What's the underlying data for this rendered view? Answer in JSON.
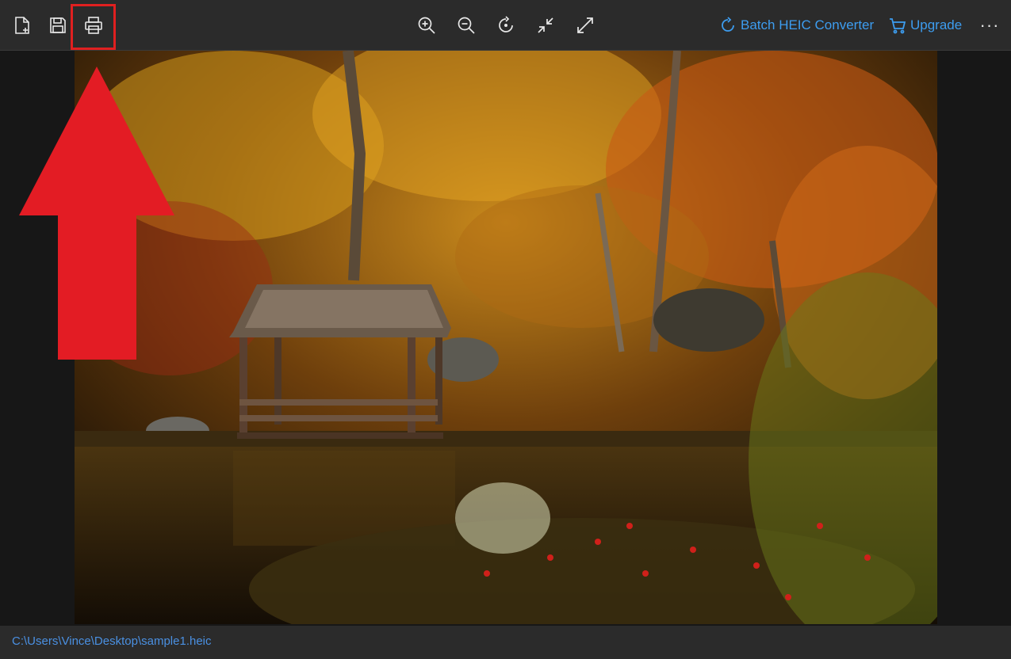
{
  "toolbar": {
    "left_icons": [
      "new-file-icon",
      "save-icon",
      "print-icon"
    ],
    "center_icons": [
      "zoom-in-icon",
      "zoom-out-icon",
      "rotate-icon",
      "shrink-icon",
      "expand-icon"
    ],
    "batch_label": "Batch HEIC Converter",
    "upgrade_label": "Upgrade",
    "more_label": "···"
  },
  "colors": {
    "accent": "#3d9df0",
    "highlight": "#e02020",
    "toolbar_bg": "#2b2b2b"
  },
  "image": {
    "content": "autumn-pond-gazebo-photo"
  },
  "status": {
    "path": "C:\\Users\\Vince\\Desktop\\sample1.heic"
  }
}
